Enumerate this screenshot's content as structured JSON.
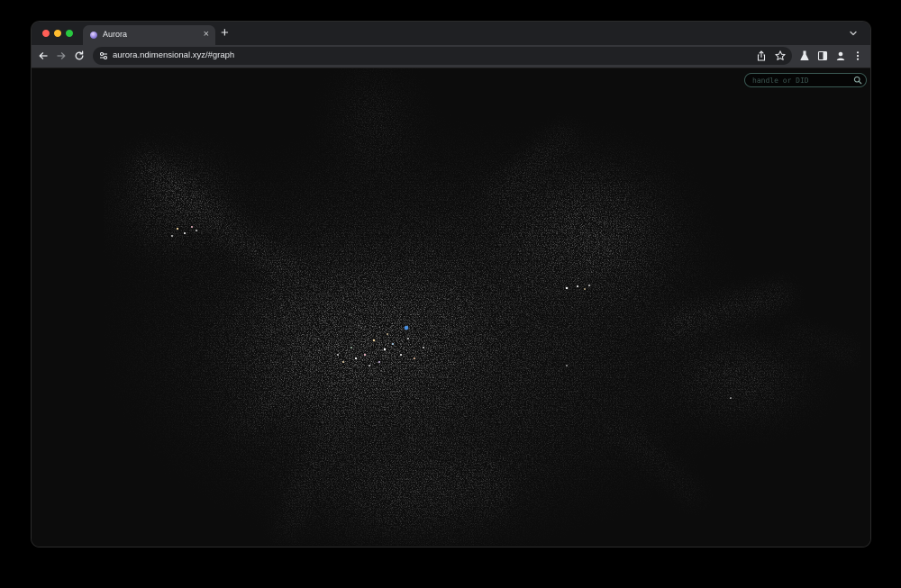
{
  "browser": {
    "tab": {
      "title": "Aurora",
      "close_glyph": "×"
    },
    "new_tab_glyph": "+",
    "address_bar": {
      "url": "aurora.ndimensional.xyz/#graph"
    },
    "icons": {
      "back": "arrow-left-icon",
      "forward": "arrow-right-icon",
      "reload": "reload-icon",
      "site_info": "tune-icon",
      "share": "share-icon",
      "bookmark": "star-icon",
      "labs": "flask-icon",
      "side_panel": "side-panel-icon",
      "profile": "profile-icon",
      "menu": "kebab-menu-icon",
      "tab_search": "chevron-down-icon"
    },
    "traffic_lights": {
      "close": "#ff5f57",
      "minimize": "#febc2e",
      "maximize": "#28c840"
    }
  },
  "page": {
    "search": {
      "placeholder": "handle or DID",
      "value": "",
      "icon": "search-icon",
      "border_color": "#3b5a54"
    },
    "graph": {
      "background": "#0d0d0d",
      "highlight_node_color": "#4a90e2"
    }
  }
}
